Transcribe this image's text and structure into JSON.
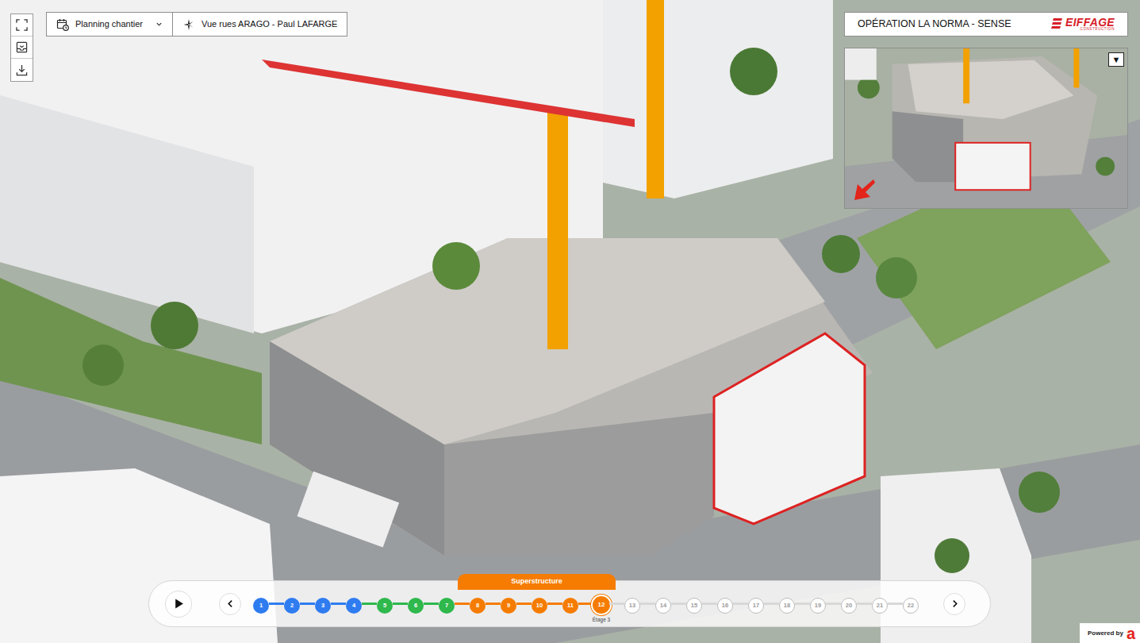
{
  "planning": {
    "label": "Planning chantier",
    "expanded": false
  },
  "view": {
    "label": "Vue rues ARAGO - Paul LAFARGE"
  },
  "header": {
    "title": "OPÉRATION LA NORMA - SENSE",
    "logo": {
      "brand": "EIFFAGE",
      "sub": "CONSTRUCTION"
    }
  },
  "minimap": {
    "toggle": "▼"
  },
  "timeline": {
    "groups": [
      {
        "color": "#2f7cf0",
        "future": false,
        "steps": [
          {
            "label": "1",
            "selected": false
          },
          {
            "label": "2",
            "selected": false
          },
          {
            "label": "3",
            "selected": false
          },
          {
            "label": "4",
            "selected": false
          }
        ]
      },
      {
        "color": "#2fb84c",
        "future": false,
        "steps": [
          {
            "label": "5",
            "selected": false
          },
          {
            "label": "6",
            "selected": false
          },
          {
            "label": "7",
            "selected": false
          }
        ]
      },
      {
        "color": "#f57c00",
        "future": false,
        "label": "Superstructure",
        "steps": [
          {
            "label": "8",
            "selected": false
          },
          {
            "label": "9",
            "selected": false
          },
          {
            "label": "10",
            "selected": false
          },
          {
            "label": "11",
            "selected": false
          },
          {
            "label": "12",
            "selected": true,
            "caption": "Étage 3"
          }
        ]
      },
      {
        "color": "#d8d8d8",
        "future": true,
        "steps": [
          {
            "label": "13",
            "selected": false
          },
          {
            "label": "14",
            "selected": false
          },
          {
            "label": "15",
            "selected": false
          },
          {
            "label": "16",
            "selected": false
          },
          {
            "label": "17",
            "selected": false
          },
          {
            "label": "18",
            "selected": false
          },
          {
            "label": "19",
            "selected": false
          },
          {
            "label": "20",
            "selected": false
          },
          {
            "label": "21",
            "selected": false
          },
          {
            "label": "22",
            "selected": false
          }
        ]
      }
    ]
  },
  "powered": {
    "label": "Powered by",
    "logo": "a"
  }
}
